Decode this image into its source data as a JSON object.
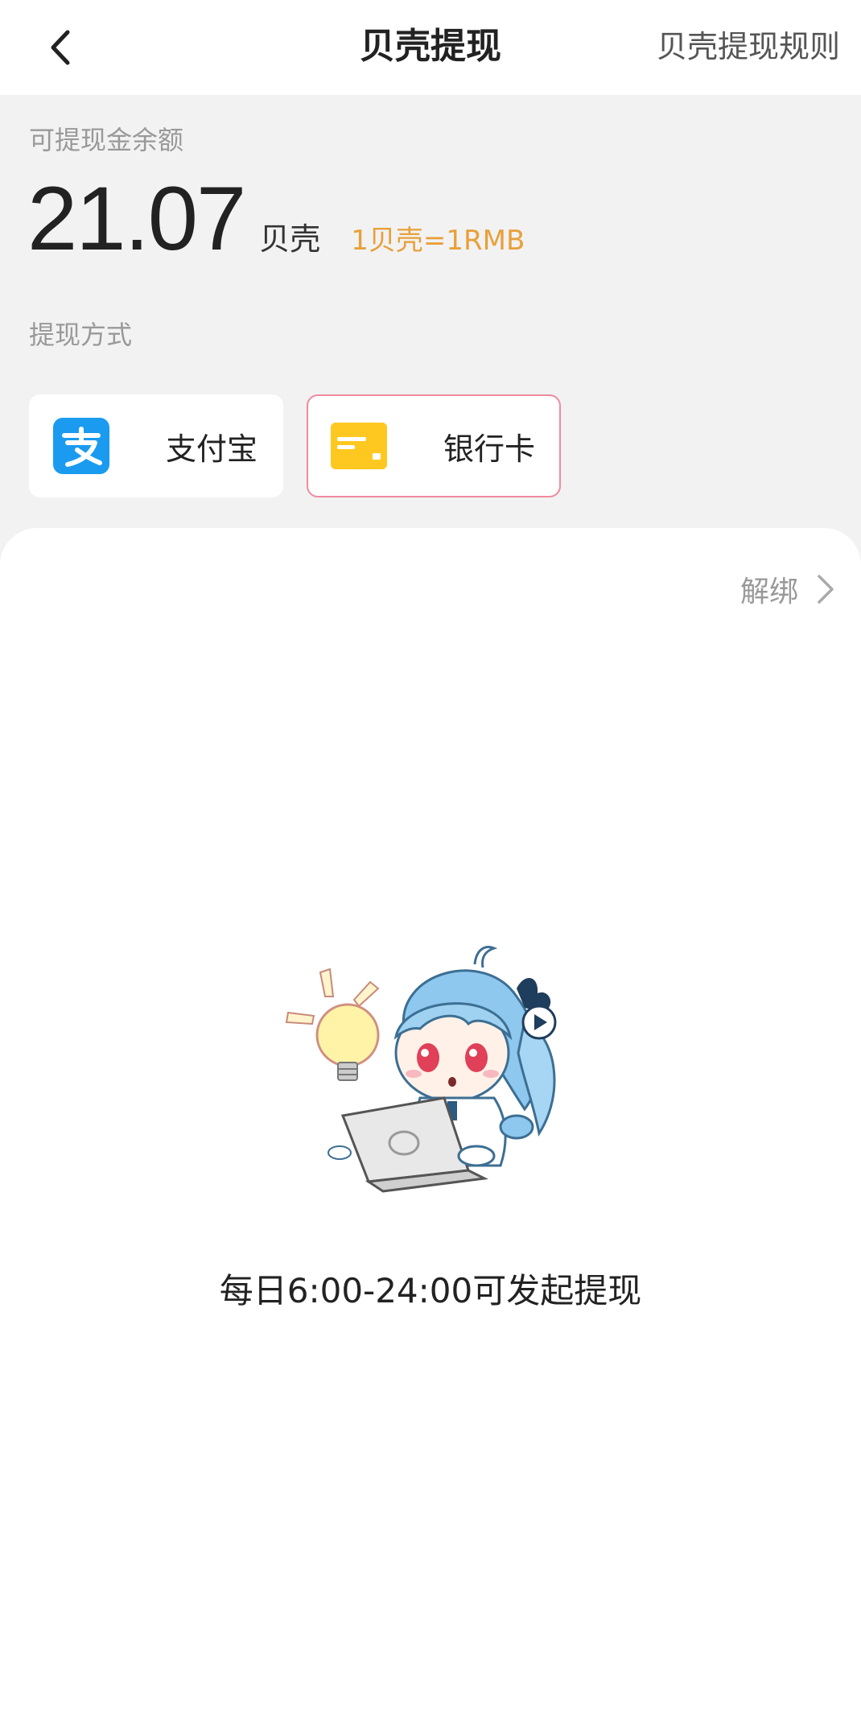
{
  "header": {
    "title": "贝壳提现",
    "rules_link": "贝壳提现规则",
    "back_icon": "chevron-left-icon"
  },
  "balance": {
    "label": "可提现金余额",
    "amount": "21.07",
    "unit": "贝壳",
    "exchange_rate": "1贝壳=1RMB",
    "exchange_color": "#e8a03a"
  },
  "withdraw_methods": {
    "label": "提现方式",
    "items": [
      {
        "label": "支付宝",
        "icon": "alipay-icon",
        "color": "#1a9bf0",
        "selected": false
      },
      {
        "label": "银行卡",
        "icon": "bank-card-icon",
        "color": "#ffc820",
        "selected": true
      }
    ],
    "selected_border_color": "#f08aa0"
  },
  "panel": {
    "unbind_label": "解绑",
    "hint": "每日6:00-24:00可发起提现",
    "illustration": "mascot-laptop-lightbulb-illustration"
  }
}
